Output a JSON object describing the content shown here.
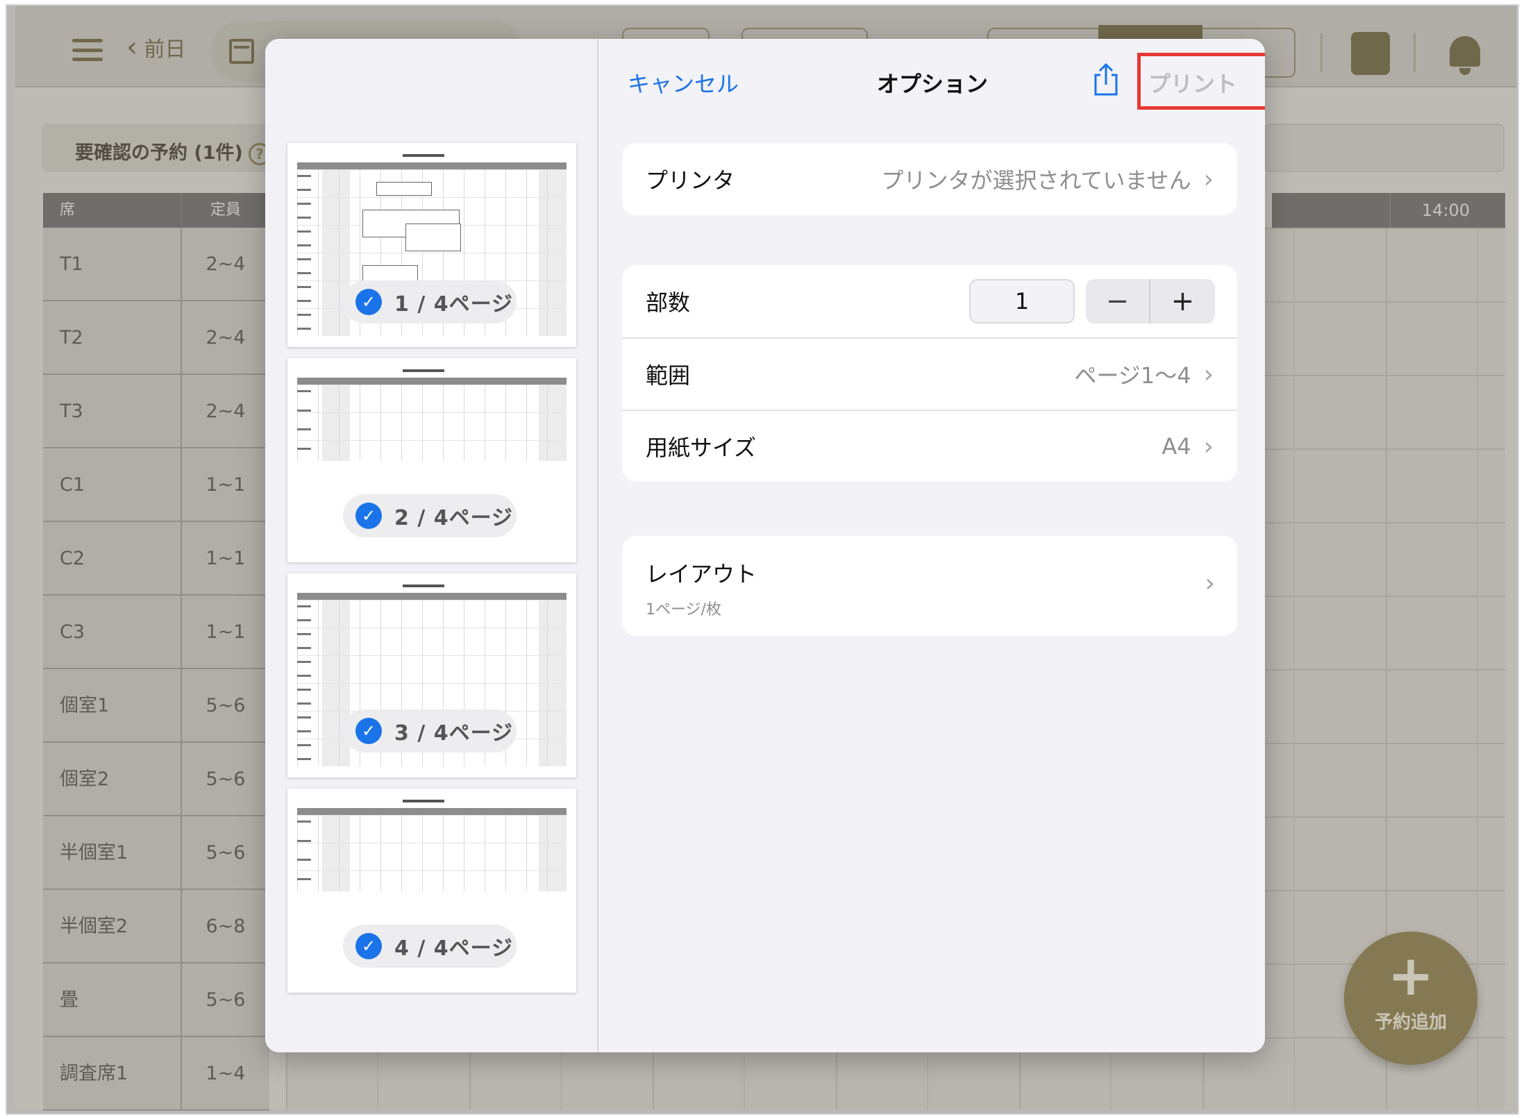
{
  "app": {
    "prev_day": "前日",
    "pending_label": "要確認の予約 (1件)",
    "seat_col": "席",
    "capacity_col": "定員",
    "time_label": "14:00",
    "add_button": "予約追加",
    "seats": [
      {
        "name": "T1",
        "capacity": "2~4"
      },
      {
        "name": "T2",
        "capacity": "2~4"
      },
      {
        "name": "T3",
        "capacity": "2~4"
      },
      {
        "name": "C1",
        "capacity": "1~1"
      },
      {
        "name": "C2",
        "capacity": "1~1"
      },
      {
        "name": "C3",
        "capacity": "1~1"
      },
      {
        "name": "個室1",
        "capacity": "5~6"
      },
      {
        "name": "個室2",
        "capacity": "5~6"
      },
      {
        "name": "半個室1",
        "capacity": "5~6"
      },
      {
        "name": "半個室2",
        "capacity": "6~8"
      },
      {
        "name": "畳",
        "capacity": "5~6"
      },
      {
        "name": "調査席1",
        "capacity": "1~4"
      }
    ]
  },
  "print_dialog": {
    "cancel": "キャンセル",
    "title": "オプション",
    "print": "プリント",
    "printer_label": "プリンタ",
    "printer_value": "プリンタが選択されていません",
    "copies_label": "部数",
    "copies_value": "1",
    "stepper_minus": "−",
    "stepper_plus": "+",
    "range_label": "範囲",
    "range_value": "ページ1〜4",
    "paper_label": "用紙サイズ",
    "paper_value": "A4",
    "layout_label": "レイアウト",
    "layout_value": "1ページ/枚",
    "pages": [
      "1 / 4ページ",
      "2 / 4ページ",
      "3 / 4ページ",
      "4 / 4ページ"
    ]
  },
  "icons": {
    "check": "✓",
    "chevron": "›",
    "question": "?"
  },
  "colors": {
    "accent_blue": "#1a73e8",
    "brand_olive": "#6b6139",
    "highlight_red": "#e53935"
  }
}
